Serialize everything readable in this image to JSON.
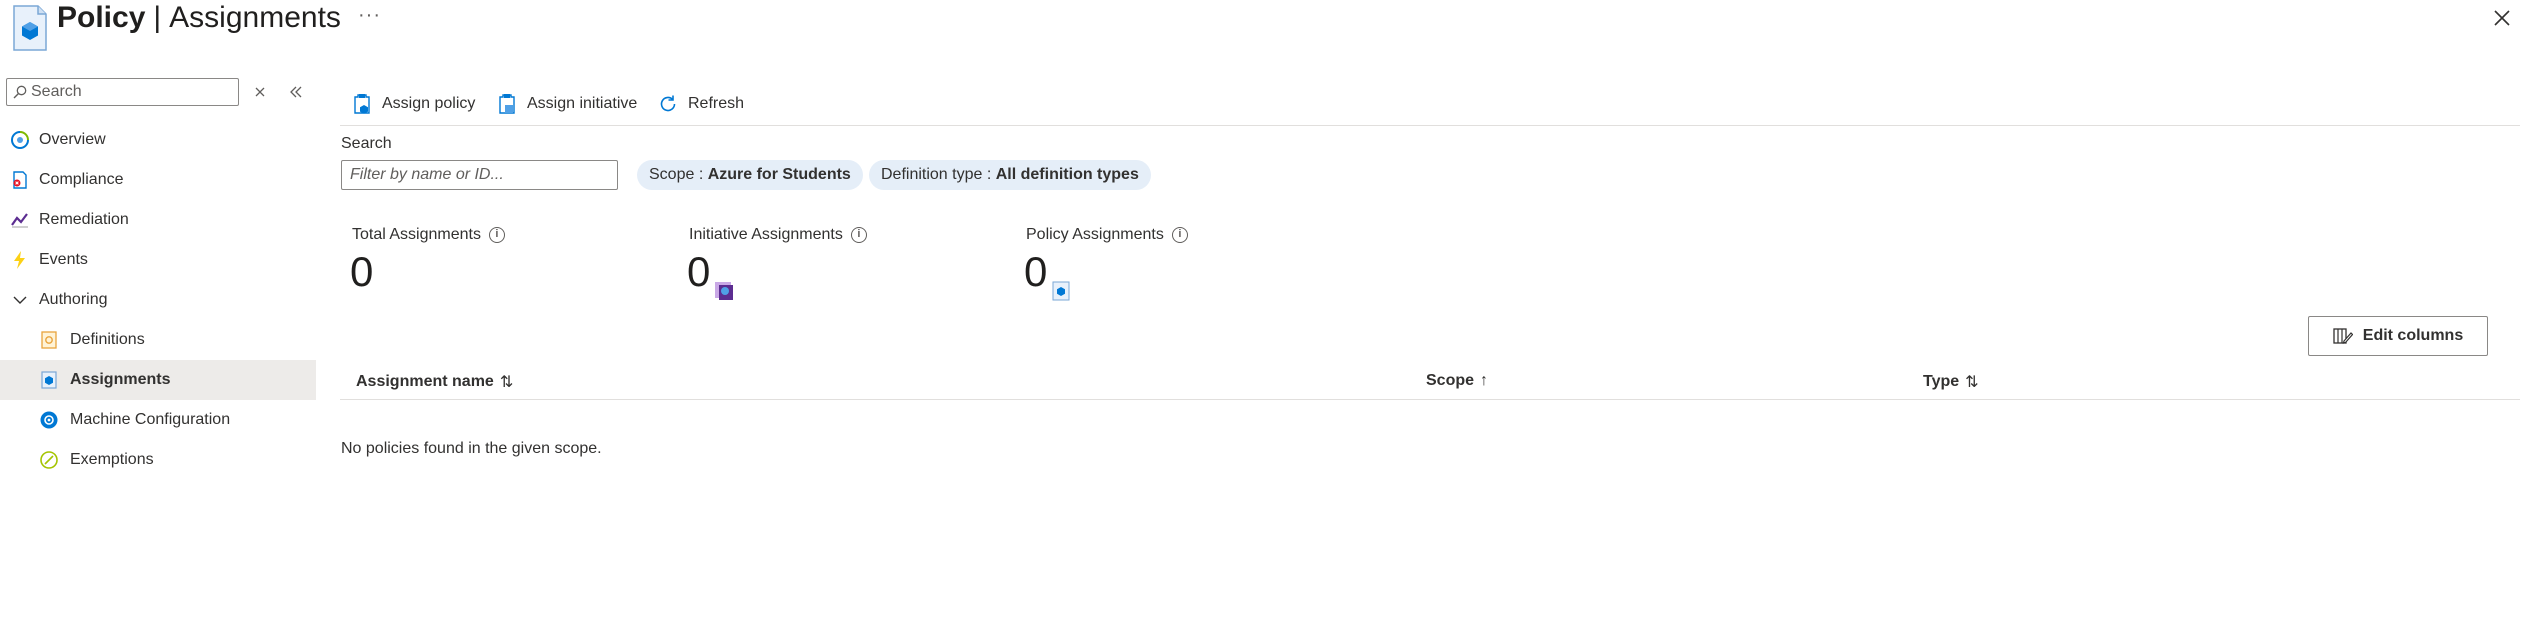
{
  "header": {
    "title_bold": "Policy",
    "separator": "|",
    "title_sub": "Assignments",
    "more": "···",
    "close_label": "×"
  },
  "sidebar": {
    "search_placeholder": "Search",
    "items": [
      {
        "label": "Overview",
        "icon": "overview-icon"
      },
      {
        "label": "Compliance",
        "icon": "compliance-icon"
      },
      {
        "label": "Remediation",
        "icon": "remediation-icon"
      },
      {
        "label": "Events",
        "icon": "events-icon"
      },
      {
        "label": "Authoring",
        "icon": "chevron-down-icon"
      },
      {
        "label": "Definitions",
        "icon": "definitions-icon"
      },
      {
        "label": "Assignments",
        "icon": "assignments-icon",
        "active": true
      },
      {
        "label": "Machine Configuration",
        "icon": "machine-configuration-icon"
      },
      {
        "label": "Exemptions",
        "icon": "exemptions-icon"
      }
    ]
  },
  "toolbar": {
    "assign_policy": "Assign policy",
    "assign_initiative": "Assign initiative",
    "refresh": "Refresh"
  },
  "filters": {
    "search_label": "Search",
    "search_placeholder": "Filter by name or ID...",
    "scope_key": "Scope : ",
    "scope_value": "Azure for Students",
    "deftype_key": "Definition type : ",
    "deftype_value": "All definition types"
  },
  "metrics": [
    {
      "label": "Total Assignments",
      "value": "0"
    },
    {
      "label": "Initiative Assignments",
      "value": "0"
    },
    {
      "label": "Policy Assignments",
      "value": "0"
    }
  ],
  "edit_columns": "Edit columns",
  "table": {
    "columns": [
      {
        "label": "Assignment name",
        "sort": "⇅"
      },
      {
        "label": "Scope",
        "sort": "↑"
      },
      {
        "label": "Type",
        "sort": "⇅"
      }
    ],
    "empty_message": "No policies found in the given scope."
  },
  "colors": {
    "accent": "#0078d4",
    "pill_bg": "#e5eef8",
    "active_nav_bg": "#edebe9"
  }
}
